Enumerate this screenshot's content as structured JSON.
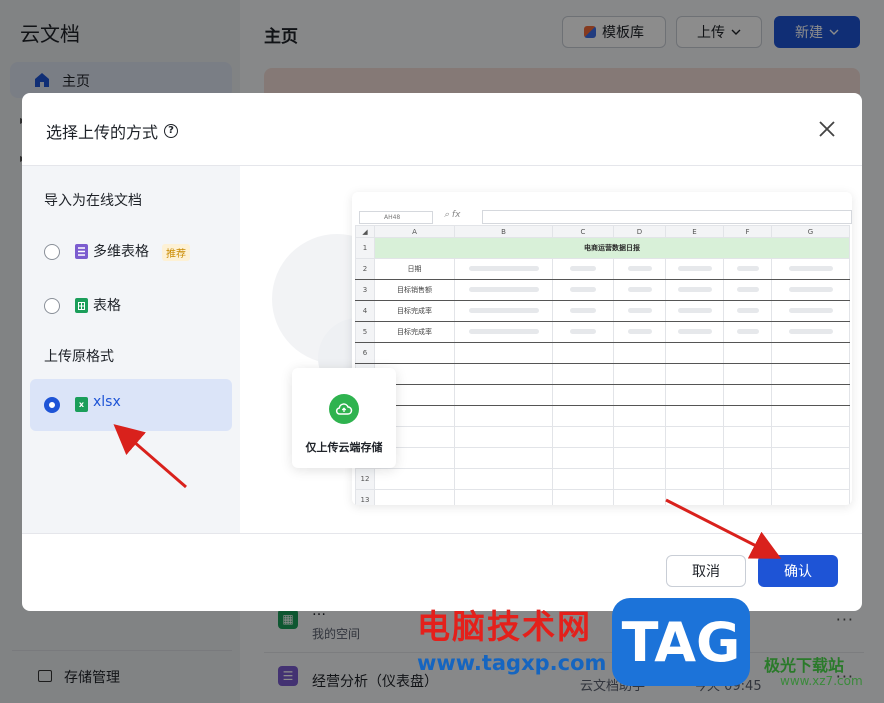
{
  "app": {
    "title": "云文档",
    "home_label": "主页",
    "storage_label": "存储管理"
  },
  "main": {
    "title": "主页",
    "template_button": "模板库",
    "upload_button": "上传",
    "new_button": "新建"
  },
  "files": [
    {
      "name": "…",
      "sub": "我的空间",
      "location": "",
      "time": "",
      "icon_color": "#1b9e5a"
    },
    {
      "name": "经营分析（仪表盘）",
      "sub": "",
      "location": "云文档助手",
      "time": "今天 09:45",
      "icon_color": "#7b5ccf"
    }
  ],
  "modal": {
    "title": "选择上传的方式",
    "section_online": "导入为在线文档",
    "section_original": "上传原格式",
    "options": [
      {
        "label": "多维表格",
        "badge": "推荐",
        "icon_color": "#7b5ccf",
        "selected": false
      },
      {
        "label": "表格",
        "icon_color": "#1b9e5a",
        "selected": false
      },
      {
        "label": "xlsx",
        "icon_color": "#1b9e5a",
        "selected": true
      }
    ],
    "preview": {
      "cell_ref": "AH48",
      "fx": "fx",
      "columns": [
        "A",
        "B",
        "C",
        "D",
        "E",
        "F",
        "G"
      ],
      "rows": [
        "1",
        "2",
        "3",
        "4",
        "5",
        "6",
        "7",
        "8",
        "9",
        "10",
        "11",
        "12",
        "13"
      ],
      "sheet_title": "电商运营数据日报",
      "row_labels": [
        "日期",
        "目标销售额",
        "目标完成率",
        "目标完成率"
      ],
      "upload_card_label": "仅上传云端存储"
    },
    "cancel_button": "取消",
    "confirm_button": "确认"
  },
  "watermark": {
    "text": "电脑技术网",
    "url": "www.tagxp.com",
    "tag": "TAG",
    "site": "极光下载站",
    "site_url": "www.xz7.com"
  },
  "colors": {
    "primary": "#1e54d6",
    "overlay": "rgba(0,0,0,0.45)",
    "arrow": "#d9211c",
    "success": "#2fb34f"
  }
}
